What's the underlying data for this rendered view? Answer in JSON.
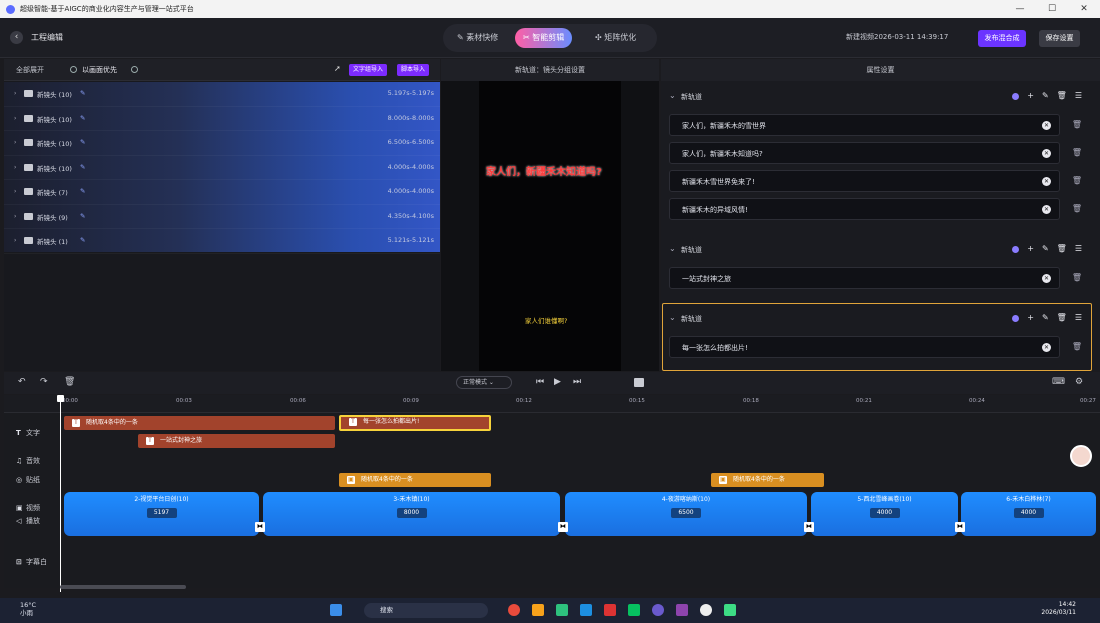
{
  "window": {
    "title": "超级智能-基于AIGC的商业化内容生产与管理一站式平台",
    "controls": [
      "—",
      "☐",
      "✕"
    ]
  },
  "header": {
    "back_label": "‹",
    "page_title": "工程编辑",
    "tabs": [
      {
        "label": "素材快修",
        "icon": "✎"
      },
      {
        "label": "智能剪辑",
        "icon": "✂"
      },
      {
        "label": "矩阵优化",
        "icon": "✣"
      }
    ],
    "new_video": "新建视频2026-03-11 14:39:17",
    "publish_button": "发布混合成",
    "save_button": "保存设置"
  },
  "left_panel": {
    "expand_all": "全部展开",
    "priority_label": "以画面优先",
    "text_import": "文字组导入",
    "script_import": "脚本导入",
    "shots": [
      {
        "name": "新镜头 (10)",
        "time": "5.197s-5.197s"
      },
      {
        "name": "新镜头 (10)",
        "time": "8.000s-8.000s"
      },
      {
        "name": "新镜头 (10)",
        "time": "6.500s-6.500s"
      },
      {
        "name": "新镜头 (10)",
        "time": "4.000s-4.000s"
      },
      {
        "name": "新镜头 (7)",
        "time": "4.000s-4.000s"
      },
      {
        "name": "新镜头 (9)",
        "time": "4.350s-4.100s"
      },
      {
        "name": "新镜头 (1)",
        "time": "5.121s-5.121s"
      }
    ]
  },
  "preview": {
    "header": "新轨道：镜头分组设置",
    "title_text": "家人们，新疆禾木知道吗?",
    "subtitle_text": "家人们谁懂啊?"
  },
  "properties": {
    "header": "属性设置",
    "tracks": [
      {
        "label": "新轨道",
        "items": [
          "家人们，新疆禾木的雪世界",
          "家人们，新疆禾木知道吗?",
          "新疆禾木雪世界免来了!",
          "新疆禾木的异域风情!"
        ]
      },
      {
        "label": "新轨道",
        "items": [
          "一站式封神之旅"
        ]
      },
      {
        "label": "新轨道",
        "items": [
          "每一张怎么拍都出片!"
        ]
      }
    ]
  },
  "controls": {
    "speed": "正常模式"
  },
  "ruler": [
    "00:00",
    "00:03",
    "00:06",
    "00:09",
    "00:12",
    "00:15",
    "00:18",
    "00:21",
    "00:24",
    "00:27"
  ],
  "tracks": {
    "text_label": "文字",
    "audio_label": "音效",
    "sticker_label": "贴纸",
    "video_label": "视频",
    "voice_label": "播放",
    "subtitle_label": "字幕白",
    "text_clips": [
      "随机取4条中的一条",
      "每一张怎么拍都出片!",
      "一站式封神之旅"
    ],
    "sticker_clips": [
      "随机取4条中的一条",
      "随机取4条中的一条"
    ],
    "video_clips": [
      {
        "title": "2-视觉平台日创(10)",
        "value": "5197"
      },
      {
        "title": "3-禾木镇(10)",
        "value": "8000"
      },
      {
        "title": "4-夜游喀纳斯(10)",
        "value": "6500"
      },
      {
        "title": "5-西北雪峰画卷(10)",
        "value": "4000"
      },
      {
        "title": "6-禾木白桦林(7)",
        "value": "4000"
      }
    ]
  },
  "taskbar": {
    "weather_temp": "16°C",
    "weather_desc": "小雨",
    "search": "搜索",
    "time": "14:42",
    "date": "2026/03/11"
  },
  "colors": {
    "accent": "#6b34ff",
    "video_clip": "#1f8dff",
    "text_clip": "#a2432c",
    "sticker_clip": "#d98f21"
  }
}
